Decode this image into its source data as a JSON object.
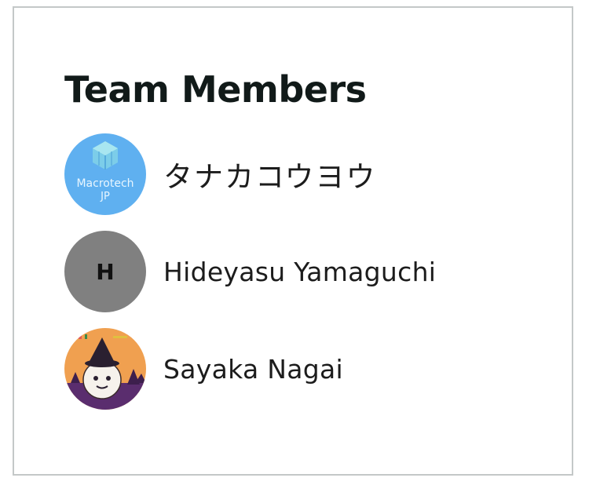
{
  "panel": {
    "title": "Team Members"
  },
  "members": [
    {
      "name": "タナカコウヨウ",
      "avatar": {
        "type": "logo",
        "icon": "macrotech-logo-icon",
        "logo_line1": "Macrotech",
        "logo_line2": "JP",
        "background": "#5fb0f0"
      }
    },
    {
      "name": "Hideyasu Yamaguchi",
      "avatar": {
        "type": "initial",
        "initial": "H",
        "background": "#808080"
      }
    },
    {
      "name": "Sayaka Nagai",
      "avatar": {
        "type": "illustration",
        "icon": "halloween-illustration-icon",
        "background": "#f0a050"
      }
    }
  ]
}
